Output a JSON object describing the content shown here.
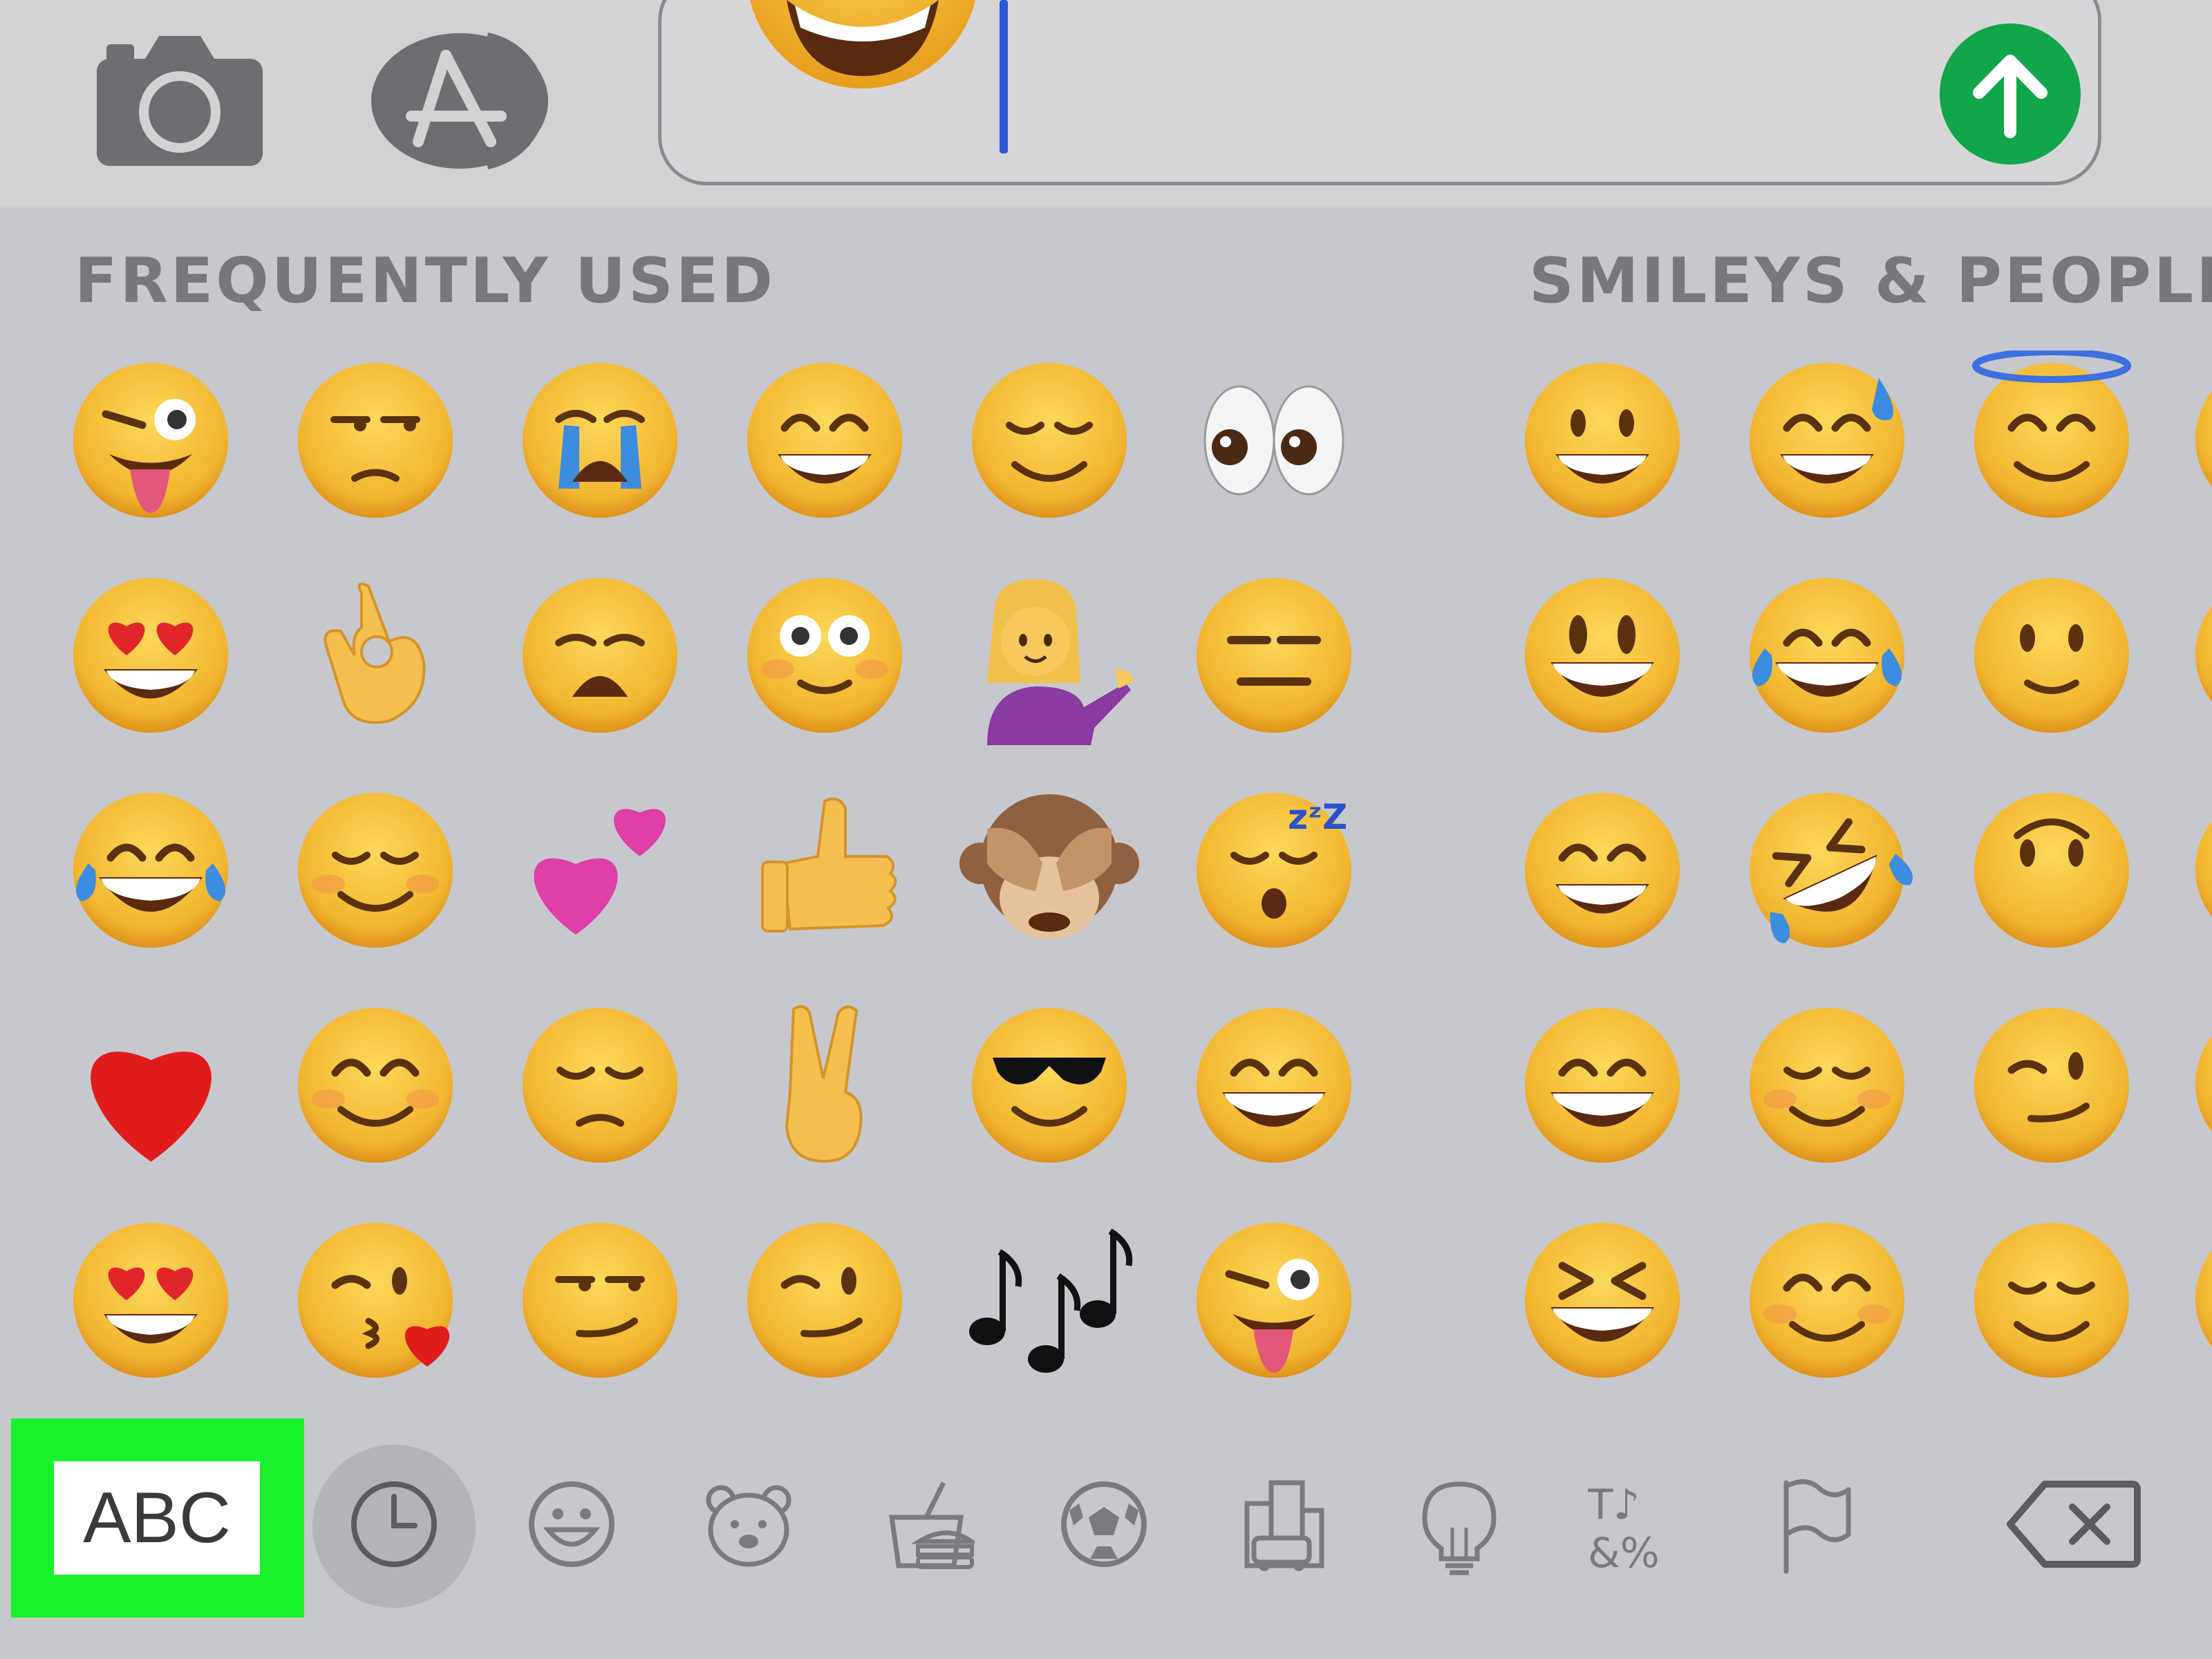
{
  "composer": {
    "camera_icon": "camera-icon",
    "app_store_icon": "app-store-icon",
    "send_icon": "send-arrow-icon",
    "send_color": "#11a64a",
    "input_emoji": "grinning-face"
  },
  "sections": {
    "frequently_used": "FREQUENTLY USED",
    "smileys_people": "SMILEYS & PEOPLE"
  },
  "emoji_grid": {
    "frequently_used": [
      [
        "winking-face-with-tongue",
        "unamused-face",
        "loudly-crying-face",
        "grinning-face-with-smiling-eyes",
        "relieved-face",
        "eyes"
      ],
      [
        "smiling-face-with-heart-eyes",
        "ok-hand",
        "weary-face",
        "flushed-face",
        "person-tipping-hand",
        "expressionless-face"
      ],
      [
        "face-with-tears-of-joy",
        "smiling-face",
        "two-hearts",
        "thumbs-up",
        "see-no-evil-monkey",
        "sleeping-face"
      ],
      [
        "red-heart",
        "smiling-face-with-smiling-eyes",
        "pensive-face",
        "victory-hand",
        "smiling-face-with-sunglasses",
        "beaming-face"
      ],
      [
        "smiling-face-with-heart-eyes",
        "face-blowing-a-kiss",
        "smirking-face",
        "winking-face",
        "musical-notes",
        "winking-face-with-tongue"
      ]
    ],
    "smileys_people": [
      [
        "grinning-face",
        "grinning-face-with-sweat",
        "smiling-face-with-halo"
      ],
      [
        "grinning-face-with-big-eyes",
        "face-with-tears-of-joy",
        "slightly-smiling-face"
      ],
      [
        "grinning-face-with-smiling-eyes",
        "rolling-on-the-floor-laughing",
        "upside-down-face"
      ],
      [
        "beaming-face",
        "smiling-face",
        "winking-face"
      ],
      [
        "grinning-squinting-face",
        "smiling-face-with-smiling-eyes",
        "relieved-face"
      ]
    ]
  },
  "keyboard_bar": {
    "abc_label": "ABC",
    "highlight_color": "#19f22b",
    "categories": [
      {
        "name": "recent",
        "icon": "clock-icon"
      },
      {
        "name": "smileys",
        "icon": "smiley-icon"
      },
      {
        "name": "animals",
        "icon": "bear-icon"
      },
      {
        "name": "food",
        "icon": "burger-icon"
      },
      {
        "name": "activity",
        "icon": "soccer-ball-icon"
      },
      {
        "name": "travel",
        "icon": "buildings-car-icon"
      },
      {
        "name": "objects",
        "icon": "lightbulb-icon"
      },
      {
        "name": "symbols",
        "icon": "symbols-icon"
      },
      {
        "name": "flags",
        "icon": "flag-icon"
      }
    ],
    "delete_icon": "backspace-icon"
  }
}
